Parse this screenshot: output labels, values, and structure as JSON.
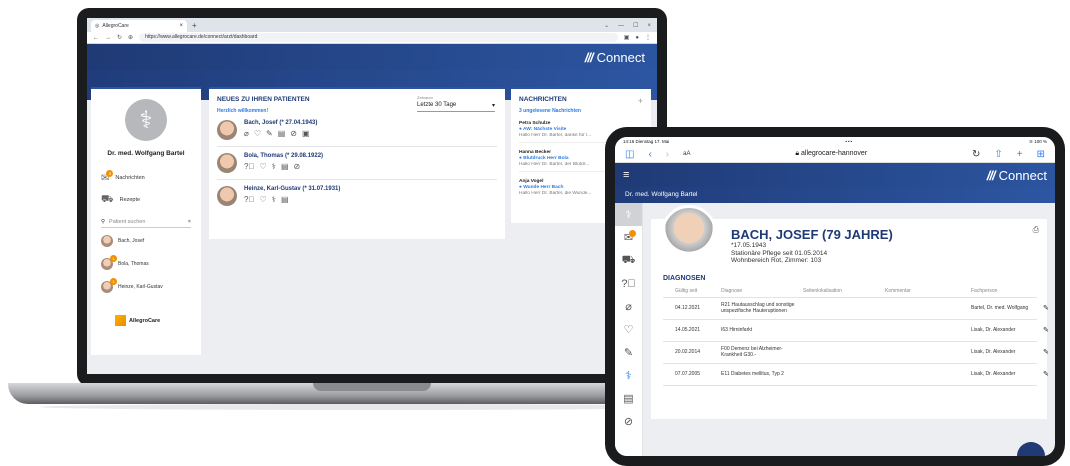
{
  "laptop": {
    "browser": {
      "tab_title": "AllegroCare",
      "tab_close": "×",
      "new_tab": "+",
      "window_controls": [
        "⌄",
        "—",
        "☐",
        "×"
      ],
      "url": "https://www.allegrocare.de/connect/arzt/dashboard"
    },
    "app": {
      "brand": "Connect",
      "sidebar": {
        "doctor_name": "Dr. med. Wolfgang Bartel",
        "nav": [
          {
            "label": "Nachrichten",
            "badge": "3"
          },
          {
            "label": "Rezepte"
          }
        ],
        "search_placeholder": "Patient suchen",
        "patients": [
          {
            "name": "Bach, Josef"
          },
          {
            "name": "Bola, Thomas",
            "badge": "1"
          },
          {
            "name": "Heinze, Karl-Gustav",
            "badge": "1"
          }
        ],
        "logo_text": "AllegroCare"
      },
      "news": {
        "title": "NEUES ZU IHREN PATIENTEN",
        "subtitle": "Herzlich willkommen!",
        "range_label": "Zeitraum",
        "range_value": "Letzte 30 Tage",
        "patients": [
          {
            "name": "Bach, Josef (* 27.04.1943)"
          },
          {
            "name": "Bola, Thomas (* 29.08.1922)"
          },
          {
            "name": "Heinze, Karl-Gustav (* 31.07.1931)"
          }
        ]
      },
      "messages": {
        "title": "NACHRICHTEN",
        "add": "+",
        "unread": "3 ungelesene Nachrichten",
        "items": [
          {
            "from": "Petra Schulze",
            "subject": "● AW: Nächste Visite",
            "preview": "Hallo Herr Dr. Bartel, danke für I..."
          },
          {
            "from": "Hanna Becker",
            "subject": "● Blutdruck Herr Bola",
            "preview": "Hallo Herr Dr. Bartel, der Blutdr..."
          },
          {
            "from": "Anja Vogel",
            "subject": "● Wunde Herr Bach",
            "preview": "Hallo Herr Dr. Bartel, die Wunde..."
          }
        ]
      }
    }
  },
  "tablet": {
    "status": {
      "time": "14:16",
      "date": "Dienstag 17. Mai",
      "dots": "•••",
      "battery": "100 %"
    },
    "safari": {
      "aa": "aA",
      "url": "allegrocare-hannover"
    },
    "brand": "Connect",
    "doctor_bar": "Dr. med. Wolfgang Bartel",
    "patient": {
      "name": "BACH, JOSEF (79 JAHRE)",
      "birth": "*17.05.1943",
      "care": "Stationäre Pflege seit 01.05.2014",
      "room": "Wohnbereich Rot, Zimmer: 103"
    },
    "diagnoses": {
      "title": "DIAGNOSEN",
      "columns": [
        "Gültig seit",
        "Diagnose",
        "Seitenlokalisation",
        "Kommentar",
        "Fachperson"
      ],
      "rows": [
        {
          "date": "04.12.2021",
          "diagnosis": "R21 Hautausschlag und sonstige unspezifische Hauteruptionen",
          "side": "",
          "comment": "",
          "person": "Bartel, Dr. med. Wolfgang"
        },
        {
          "date": "14.05.2021",
          "diagnosis": "I63 Hirninfarkt",
          "side": "",
          "comment": "",
          "person": "Lisak, Dr. Alexander"
        },
        {
          "date": "20.02.2014",
          "diagnosis": "F00 Demenz bei Alzheimer-Krankheit G30.-",
          "side": "",
          "comment": "",
          "person": "Lisak, Dr. Alexander"
        },
        {
          "date": "07.07.2005",
          "diagnosis": "E11 Diabetes mellitus, Typ 2",
          "side": "",
          "comment": "",
          "person": "Lisak, Dr. Alexander"
        }
      ]
    }
  },
  "colors": {
    "brand_blue": "#1f3a75",
    "accent_blue": "#2c7be0",
    "badge_orange": "#f29100"
  }
}
